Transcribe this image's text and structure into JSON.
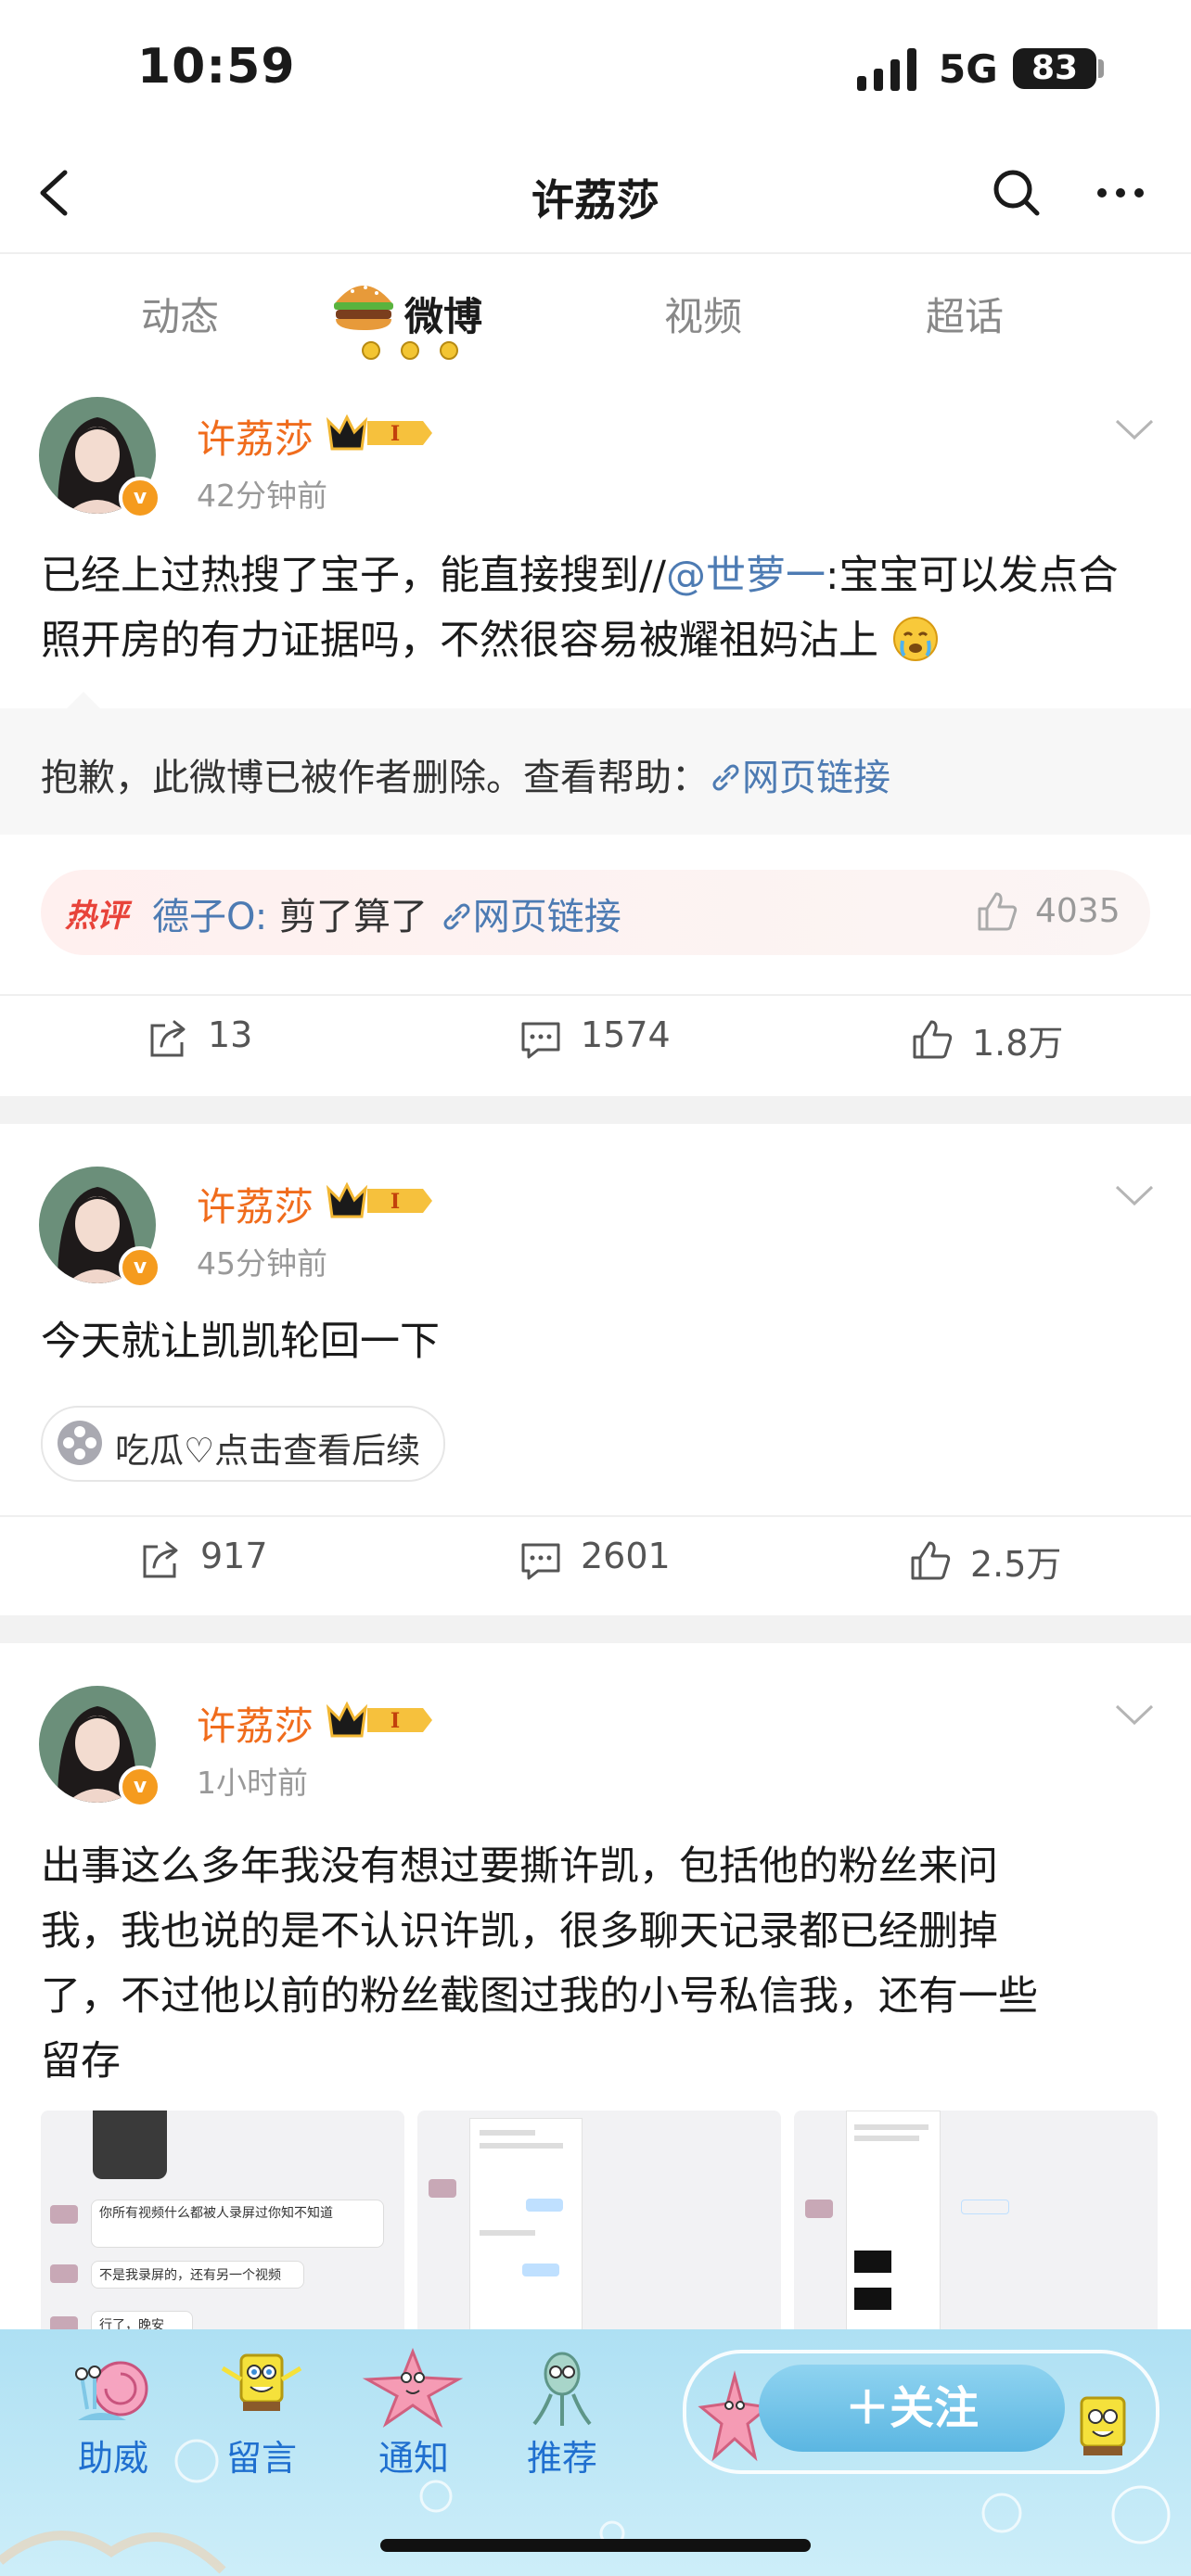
{
  "status": {
    "time": "10:59",
    "network": "5G",
    "battery": "83"
  },
  "nav": {
    "title": "许荔莎"
  },
  "tabs": [
    {
      "label": "动态"
    },
    {
      "label": "微博"
    },
    {
      "label": "视频"
    },
    {
      "label": "超话"
    }
  ],
  "posts": [
    {
      "username": "许荔莎",
      "time": "42分钟前",
      "text_before": "已经上过热搜了宝子，能直接搜到//",
      "mention": "@世萝一",
      "text_after": ":宝宝可以发点合照开房的有力证据吗，不然很容易被耀祖妈沾上",
      "repost_notice": "抱歉，此微博已被作者删除。查看帮助：",
      "repost_link": "网页链接",
      "hot_comment": {
        "tag": "热评",
        "author": "德子O:",
        "text": "剪了算了",
        "link": "网页链接",
        "likes": "4035"
      },
      "reposts": "13",
      "comments": "1574",
      "likes": "1.8万"
    },
    {
      "username": "许荔莎",
      "time": "45分钟前",
      "text": "今天就让凯凯轮回一下",
      "chip": "吃瓜♡点击查看后续",
      "reposts": "917",
      "comments": "2601",
      "likes": "2.5万"
    },
    {
      "username": "许荔莎",
      "time": "1小时前",
      "text_lines": [
        "出事这么多年我没有想过要撕许凯，包括他的粉丝来问",
        "我，我也说的是不认识许凯，很多聊天记录都已经删掉",
        "了，不过他以前的粉丝截图过我的小号私信我，还有一些",
        "留存"
      ],
      "thumb1_bubbles": [
        "你所有视频什么都被人录屏过你知不知道",
        "不是我录屏的，还有另一个视频",
        "行了，晚安"
      ]
    }
  ],
  "bottom_bar": {
    "items": [
      {
        "label": "助威"
      },
      {
        "label": "留言"
      },
      {
        "label": "通知"
      },
      {
        "label": "推荐"
      }
    ],
    "follow": "＋关注"
  },
  "colors": {
    "username": "#f06c1c",
    "link": "#4d7bb3",
    "accent_blue": "#1f6fcf"
  }
}
